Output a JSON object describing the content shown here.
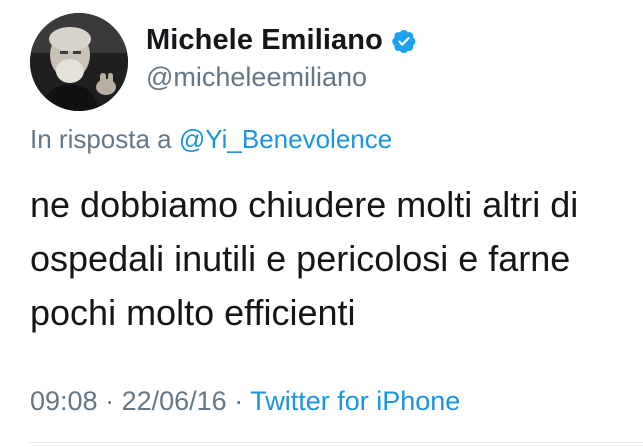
{
  "tweet": {
    "author": {
      "display_name": "Michele Emiliano",
      "handle": "@micheleemiliano",
      "verified": true,
      "avatar_icon": "avatar-photo"
    },
    "reply": {
      "prefix": "In risposta a ",
      "mention": "@Yi_Benevolence"
    },
    "text_lines": [
      "ne dobbiamo chiudere molti altri di",
      "ospedali inutili e pericolosi e farne",
      "pochi molto efficienti"
    ],
    "meta": {
      "time": "09:08",
      "separator": " · ",
      "date": "22/06/16",
      "source": "Twitter for iPhone"
    }
  },
  "colors": {
    "text_primary": "#14171a",
    "text_secondary": "#657786",
    "link": "#1b95e0",
    "verified_badge": "#1da1f2"
  }
}
